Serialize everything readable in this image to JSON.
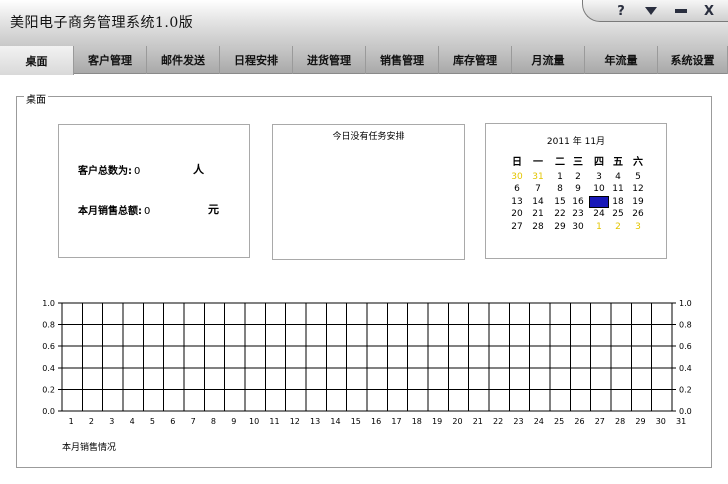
{
  "window": {
    "title": "美阳电子商务管理系统1.0版",
    "help_label": "?",
    "close_label": "X"
  },
  "tabs": [
    "桌面",
    "客户管理",
    "邮件发送",
    "日程安排",
    "进货管理",
    "销售管理",
    "库存管理",
    "月流量",
    "年流量",
    "系统设置"
  ],
  "panel": {
    "label": "桌面"
  },
  "stats": {
    "customer_label": "客户总数为:",
    "customer_value": "0",
    "customer_unit": "人",
    "sales_label": "本月销售总额:",
    "sales_value": "0",
    "sales_unit": "元"
  },
  "tasks": {
    "message": "今日没有任务安排"
  },
  "calendar": {
    "year": "2011",
    "year_suffix": "年",
    "month": "11",
    "month_suffix": "月",
    "weekdays": [
      "日",
      "一",
      "二",
      "三",
      "四",
      "五",
      "六"
    ],
    "weeks": [
      [
        "30",
        "31",
        "1",
        "2",
        "3",
        "4",
        "5"
      ],
      [
        "6",
        "7",
        "8",
        "9",
        "10",
        "11",
        "12"
      ],
      [
        "13",
        "14",
        "15",
        "16",
        "17",
        "18",
        "19"
      ],
      [
        "20",
        "21",
        "22",
        "23",
        "24",
        "25",
        "26"
      ],
      [
        "27",
        "28",
        "29",
        "30",
        "1",
        "2",
        "3"
      ]
    ],
    "other_month_cells": [
      [
        0,
        0
      ],
      [
        0,
        1
      ],
      [
        4,
        4
      ],
      [
        4,
        5
      ],
      [
        4,
        6
      ]
    ],
    "selected_cell": [
      2,
      4
    ],
    "colors": {
      "other_month": "#e3c500",
      "selected": "#1818b8"
    }
  },
  "chart_data": {
    "type": "line",
    "title": "",
    "caption": "本月销售情况",
    "x": [
      "1",
      "2",
      "3",
      "4",
      "5",
      "6",
      "7",
      "8",
      "9",
      "10",
      "11",
      "12",
      "13",
      "14",
      "15",
      "16",
      "17",
      "18",
      "19",
      "20",
      "21",
      "22",
      "23",
      "24",
      "25",
      "26",
      "27",
      "28",
      "29",
      "30",
      "31"
    ],
    "series": [],
    "ylim": [
      0,
      1.0
    ],
    "yticks": [
      "0.0",
      "0.2",
      "0.4",
      "0.6",
      "0.8",
      "1.0"
    ],
    "grid": true,
    "y_axis_both_sides": true
  }
}
